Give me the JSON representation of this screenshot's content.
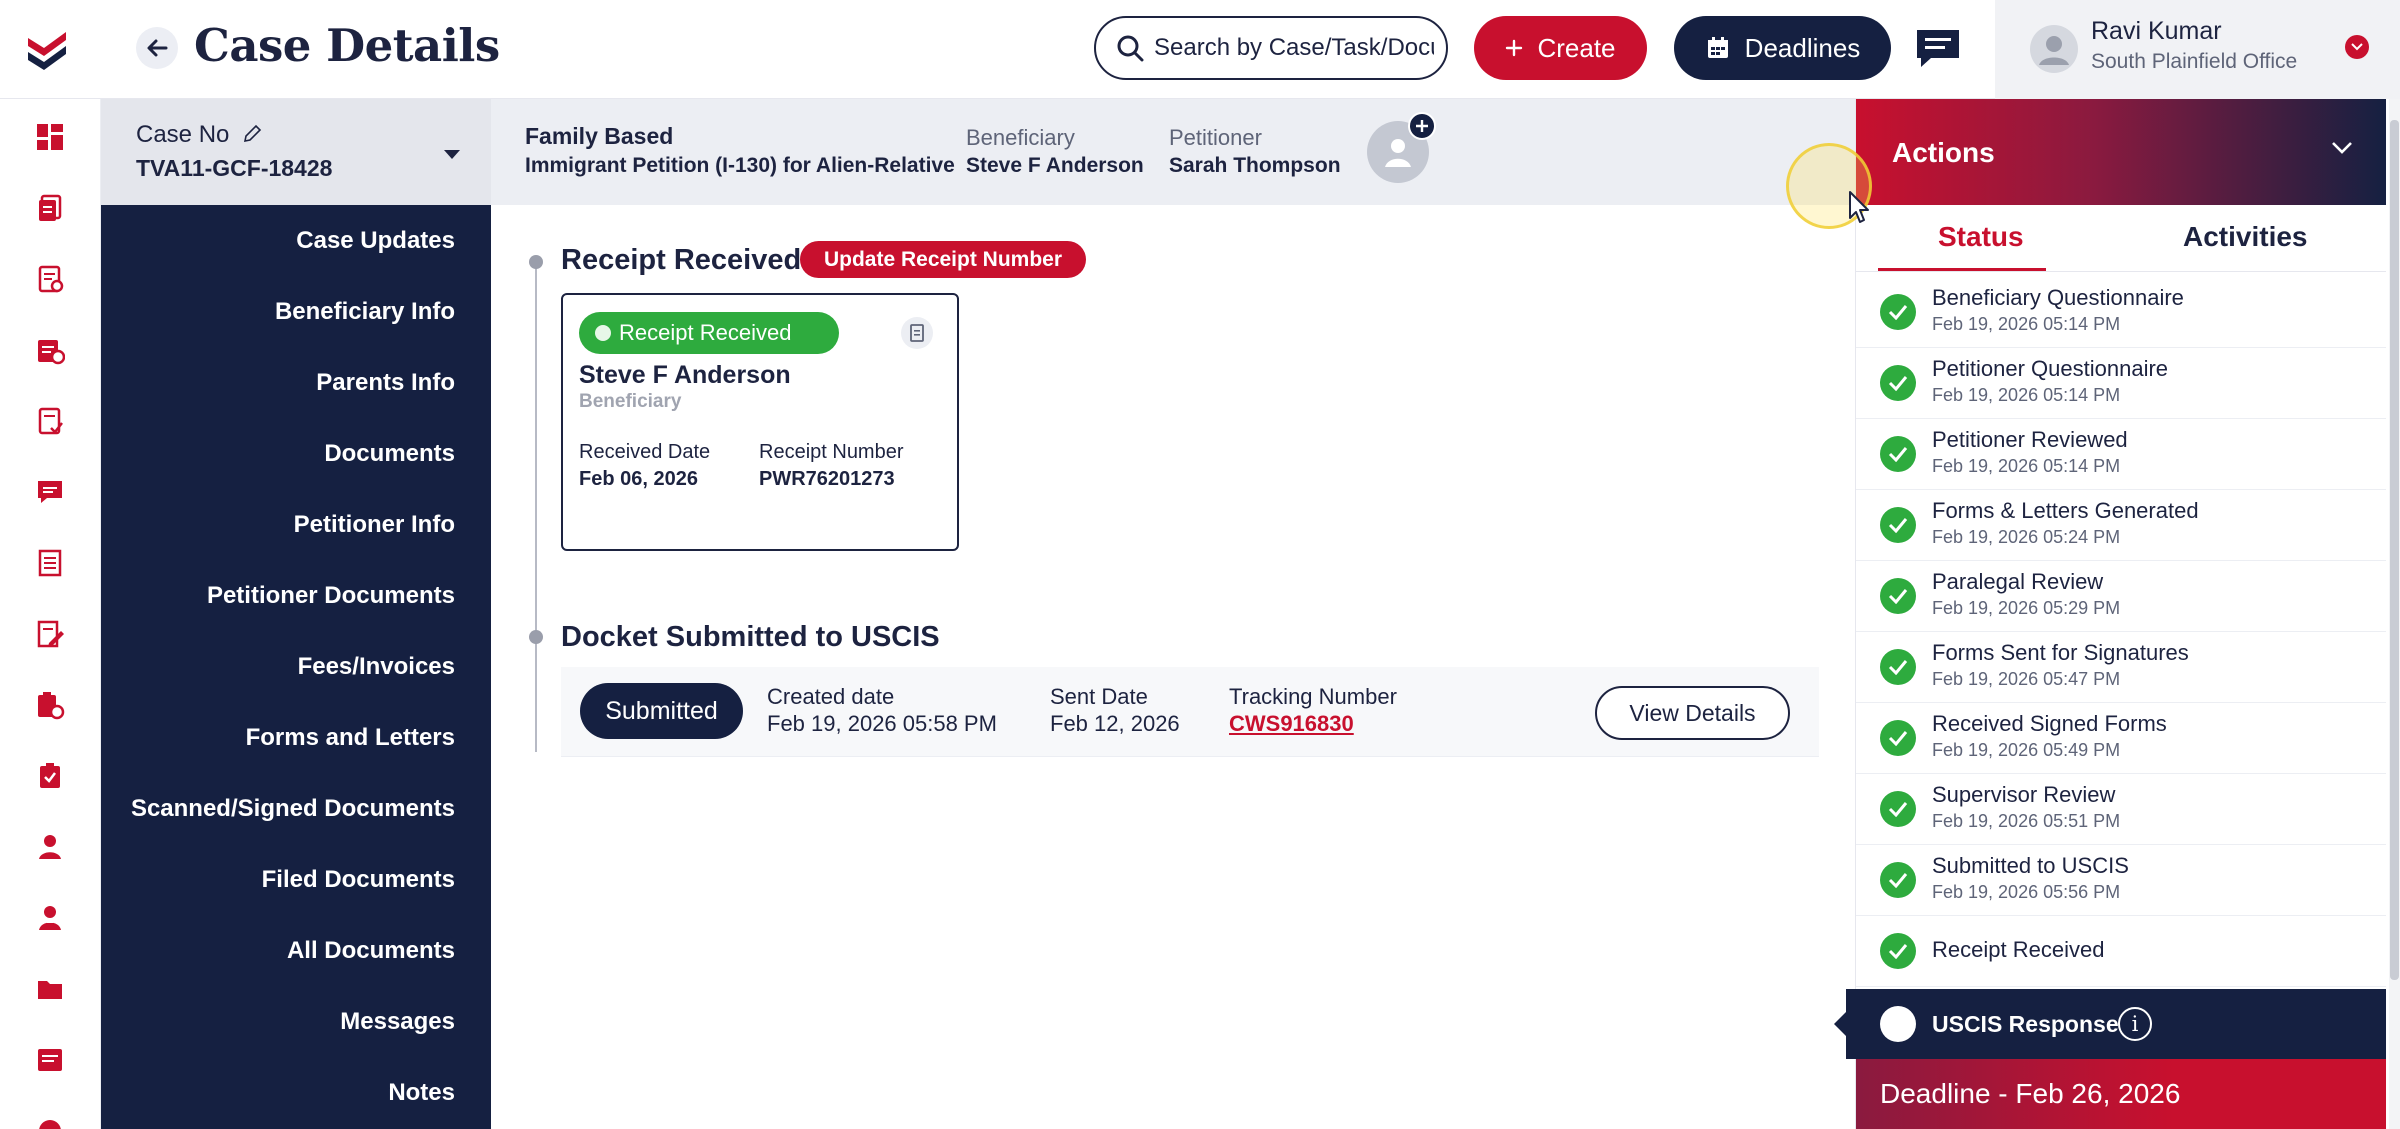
{
  "header": {
    "title": "Case Details",
    "search_placeholder": "Search by Case/Task/Document",
    "create_label": "Create",
    "deadlines_label": "Deadlines",
    "user": {
      "name": "Ravi Kumar",
      "office": "South Plainfield Office"
    }
  },
  "case": {
    "case_no_label": "Case No",
    "case_no": "TVA11-GCF-18428",
    "type_title": "Family Based",
    "type_subtitle": "Immigrant Petition (I-130) for Alien-Relative",
    "beneficiary_label": "Beneficiary",
    "beneficiary": "Steve F Anderson",
    "petitioner_label": "Petitioner",
    "petitioner": "Sarah Thompson"
  },
  "rail_icons": [
    "dashboard-icon",
    "cases-icon",
    "case-list-icon",
    "calendar-case-icon",
    "tasks-icon",
    "messages-icon",
    "ledger-icon",
    "edit-document-icon",
    "clipboard-icon",
    "checklist-icon",
    "person-icon",
    "people-icon",
    "folder-icon",
    "note-icon",
    "globe-icon"
  ],
  "menu": {
    "items": [
      "Case Updates",
      "Beneficiary Info",
      "Parents Info",
      "Documents",
      "Petitioner Info",
      "Petitioner Documents",
      "Fees/Invoices",
      "Forms and Letters",
      "Scanned/Signed Documents",
      "Filed Documents",
      "All Documents",
      "Messages",
      "Notes"
    ]
  },
  "receipt": {
    "section_title": "Receipt Received",
    "update_button": "Update Receipt Number",
    "pill": "Receipt Received",
    "name": "Steve F Anderson",
    "role": "Beneficiary",
    "received_date_label": "Received Date",
    "received_date": "Feb 06, 2026",
    "receipt_number_label": "Receipt Number",
    "receipt_number": "PWR76201273"
  },
  "docket": {
    "section_title": "Docket Submitted to USCIS",
    "status": "Submitted",
    "created_label": "Created date",
    "created": "Feb 19, 2026 05:58 PM",
    "sent_label": "Sent Date",
    "sent": "Feb 12, 2026",
    "tracking_label": "Tracking Number",
    "tracking": "CWS916830",
    "view_details": "View Details"
  },
  "actions": {
    "title": "Actions",
    "tabs": [
      "Status",
      "Activities"
    ],
    "status_items": [
      {
        "name": "Beneficiary Questionnaire",
        "date": "Feb 19, 2026 05:14 PM"
      },
      {
        "name": "Petitioner Questionnaire",
        "date": "Feb 19, 2026 05:14 PM"
      },
      {
        "name": "Petitioner Reviewed",
        "date": "Feb 19, 2026 05:14 PM"
      },
      {
        "name": "Forms & Letters Generated",
        "date": "Feb 19, 2026 05:24 PM"
      },
      {
        "name": "Paralegal Review",
        "date": "Feb 19, 2026 05:29 PM"
      },
      {
        "name": "Forms Sent for Signatures",
        "date": "Feb 19, 2026 05:47 PM"
      },
      {
        "name": "Received Signed Forms",
        "date": "Feb 19, 2026 05:49 PM"
      },
      {
        "name": "Supervisor Review",
        "date": "Feb 19, 2026 05:51 PM"
      },
      {
        "name": "Submitted to USCIS",
        "date": "Feb 19, 2026 05:56 PM"
      },
      {
        "name": "Receipt Received",
        "date": ""
      }
    ],
    "uscis_response": "USCIS Response",
    "info_glyph": "i",
    "deadline": "Deadline - Feb 26, 2026"
  },
  "colors": {
    "brand_red": "#c8102e",
    "navy": "#152041",
    "success_green": "#2eab3e"
  }
}
